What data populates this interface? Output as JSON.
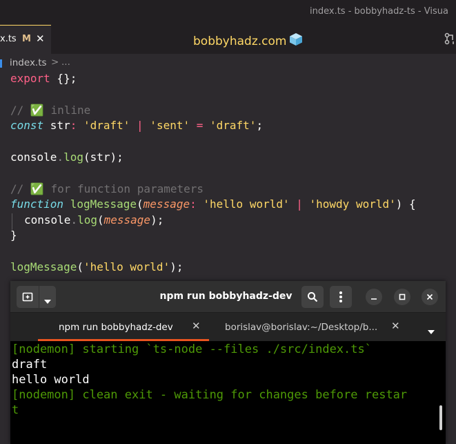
{
  "window": {
    "title": "index.ts - bobbyhadz-ts - Visua"
  },
  "editor_tab": {
    "label": "x.ts",
    "modified": "M",
    "close": "✕"
  },
  "brand": {
    "text": "bobbyhadz.com"
  },
  "breadcrumb": {
    "file": "index.ts",
    "sep": ">",
    "more": "..."
  },
  "code": {
    "l1": {
      "a": "export",
      "b": " {};"
    },
    "l2": {
      "a": "// ",
      "check": "✅",
      "b": " inline"
    },
    "l3": {
      "a": "const",
      "b": " str",
      "c": ":",
      "d": " 'draft'",
      "e": " |",
      "f": " 'sent'",
      "g": " =",
      "h": " 'draft'",
      "i": ";"
    },
    "l4": {
      "a": "console",
      "b": ".",
      "c": "log",
      "d": "(str);"
    },
    "l5": {
      "a": "// ",
      "check": "✅",
      "b": " for function parameters"
    },
    "l6": {
      "a": "function",
      "b": " logMessage",
      "c": "(",
      "d": "message",
      "e": ":",
      "f": " 'hello world'",
      "g": " |",
      "h": " 'howdy world'",
      "i": ") {"
    },
    "l7": {
      "a": "console",
      "b": ".",
      "c": "log",
      "d": "(",
      "e": "message",
      "f": ");"
    },
    "l8": {
      "a": "}"
    },
    "l9": {
      "a": "logMessage",
      "b": "(",
      "c": "'hello world'",
      "d": ");"
    }
  },
  "terminal": {
    "title": "npm run bobbyhadz-dev",
    "tabs": [
      {
        "label": "npm run bobbyhadz-dev",
        "close": "✕"
      },
      {
        "label": "borislav@borislav:~/Desktop/b...",
        "close": "✕"
      }
    ],
    "output": [
      "[nodemon] starting `ts-node --files ./src/index.ts`",
      "draft",
      "hello world",
      "[nodemon] clean exit - waiting for changes before restar",
      "t"
    ],
    "colors": {
      "nodemon": "#4e9a06",
      "text": "#ffffff",
      "accent": "#e95420"
    }
  },
  "theme": {
    "keyword": "#ff6188",
    "string": "#ffd866",
    "function": "#a9dc76",
    "storage": "#78dce8",
    "param": "#fc9867",
    "comment": "#727072"
  }
}
